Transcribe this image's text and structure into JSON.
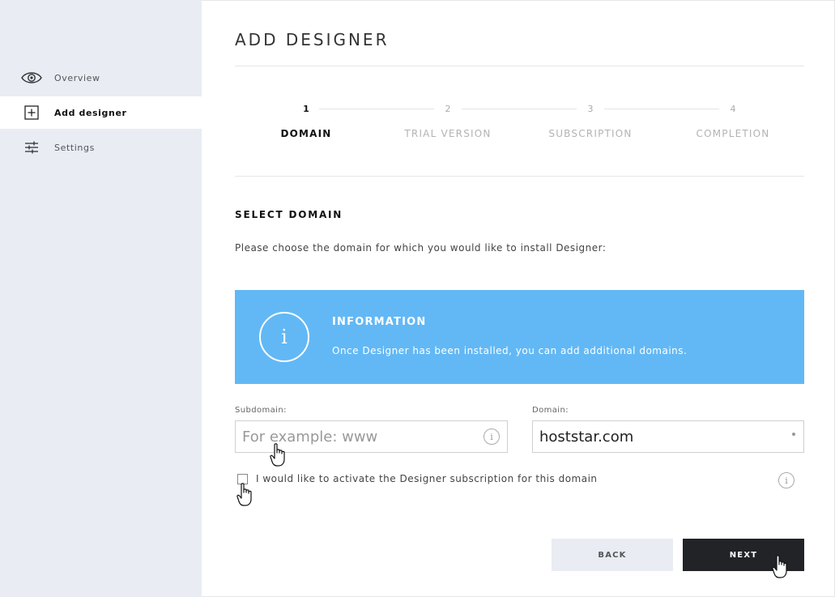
{
  "sidebar": {
    "items": [
      {
        "label": "Overview",
        "icon": "eye-icon"
      },
      {
        "label": "Add designer",
        "icon": "plus-square-icon",
        "active": true
      },
      {
        "label": "Settings",
        "icon": "sliders-icon"
      }
    ]
  },
  "main": {
    "title": "ADD DESIGNER",
    "steps": [
      {
        "number": "1",
        "label": "DOMAIN",
        "active": true
      },
      {
        "number": "2",
        "label": "TRIAL VERSION"
      },
      {
        "number": "3",
        "label": "SUBSCRIPTION"
      },
      {
        "number": "4",
        "label": "COMPLETION"
      }
    ],
    "section_title": "SELECT DOMAIN",
    "intro": "Please choose the domain for which you would like to install Designer:",
    "info": {
      "icon": "info-icon",
      "icon_glyph": "i",
      "title": "INFORMATION",
      "text": "Once Designer has been installed, you can add additional domains."
    },
    "subdomain": {
      "label": "Subdomain:",
      "placeholder": "For example: www",
      "value": ""
    },
    "domain": {
      "label": "Domain:",
      "value": "hoststar.com"
    },
    "subscription_checkbox": {
      "label": "I would like to activate the Designer subscription for this domain",
      "checked": false
    },
    "buttons": {
      "back": "BACK",
      "next": "NEXT"
    }
  },
  "colors": {
    "sidebar_bg": "#e9ecf3",
    "info_bg": "#62b8f5",
    "next_bg": "#222326",
    "back_bg": "#e9ecf3"
  }
}
